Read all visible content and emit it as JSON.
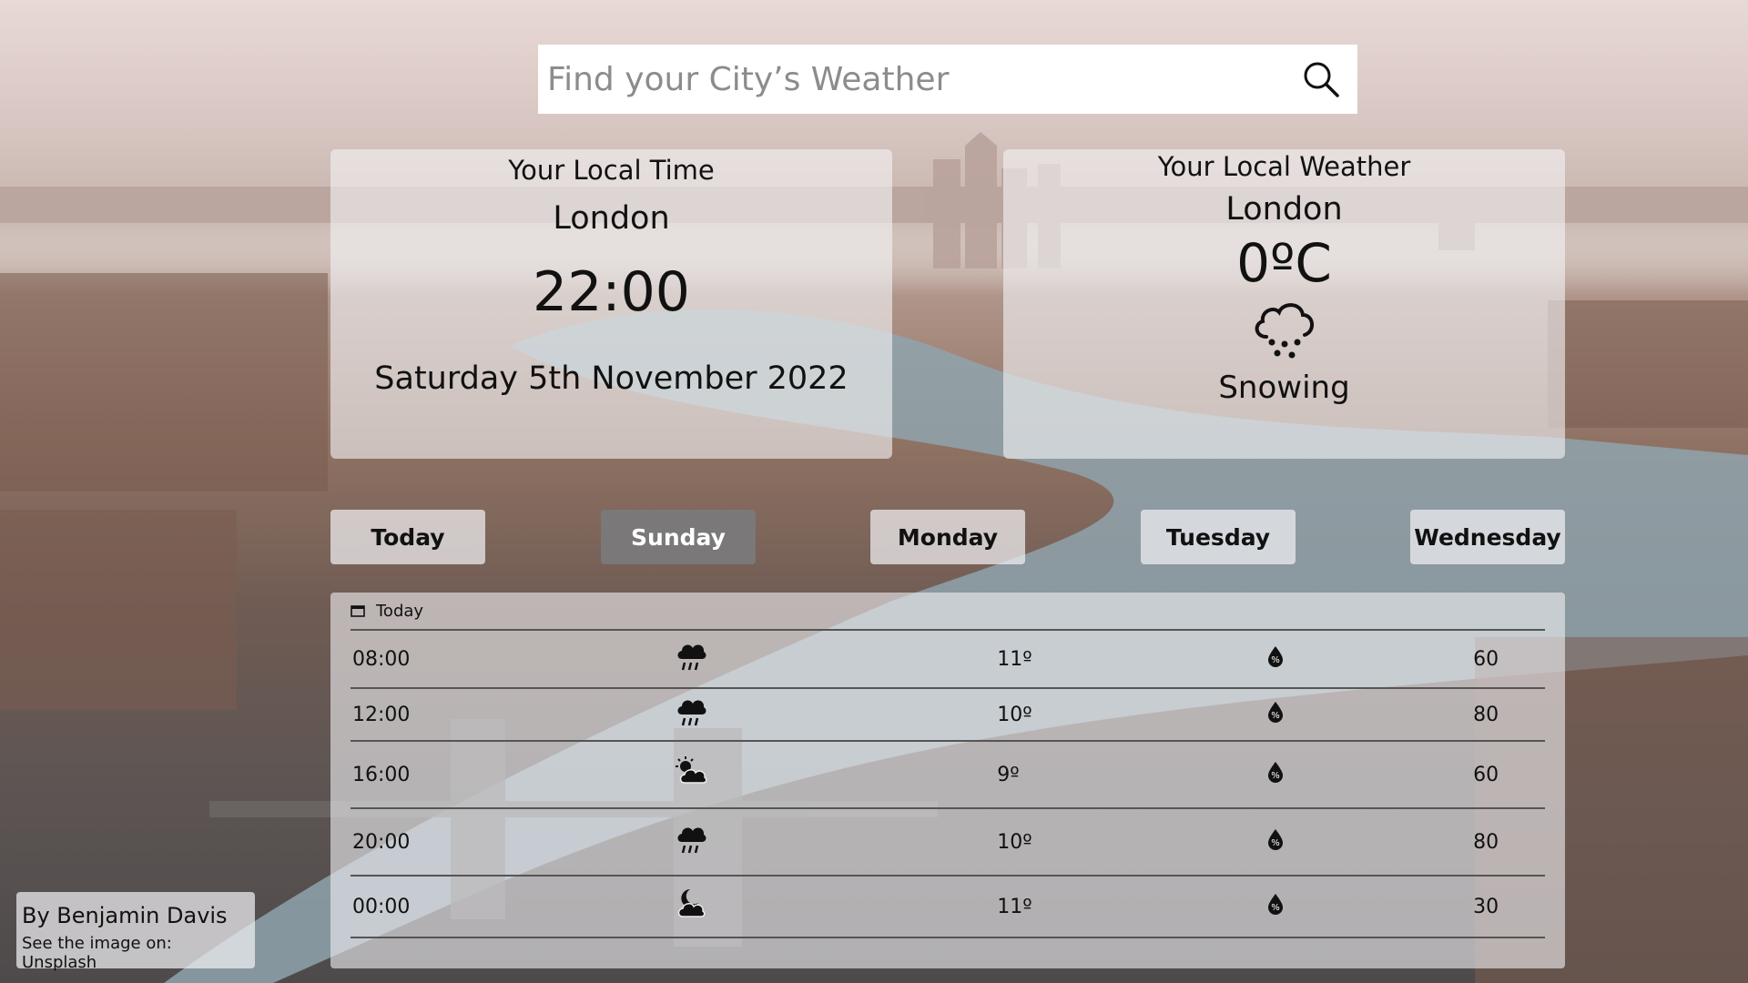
{
  "search": {
    "placeholder": "Find your City’s Weather"
  },
  "local_time": {
    "heading": "Your Local Time",
    "city": "London",
    "time": "22:00",
    "date": "Saturday 5th November 2022"
  },
  "local_weather": {
    "heading": "Your Local Weather",
    "city": "London",
    "temperature": "0ºC",
    "condition": "Snowing",
    "icon": "snow-cloud-icon"
  },
  "tabs": [
    {
      "label": "Today"
    },
    {
      "label": "Sunday",
      "active": true
    },
    {
      "label": "Monday"
    },
    {
      "label": "Tuesday"
    },
    {
      "label": "Wednesday"
    }
  ],
  "forecast": {
    "header": "Today",
    "rows": [
      {
        "time": "08:00",
        "icon": "rain-cloud-icon",
        "temp": "11º",
        "humidity": "60"
      },
      {
        "time": "12:00",
        "icon": "rain-cloud-icon",
        "temp": "10º",
        "humidity": "80"
      },
      {
        "time": "16:00",
        "icon": "sun-cloud-icon",
        "temp": "9º",
        "humidity": "60"
      },
      {
        "time": "20:00",
        "icon": "rain-cloud-icon",
        "temp": "10º",
        "humidity": "80"
      },
      {
        "time": "00:00",
        "icon": "moon-cloud-icon",
        "temp": "11º",
        "humidity": "30"
      }
    ]
  },
  "credit": {
    "by": "By Benjamin Davis",
    "link": "See the image on: Unsplash"
  },
  "colors": {
    "tab_active": "#7a7878",
    "panel_bg": "#f2f2f4",
    "river": "#8fa3ad"
  }
}
